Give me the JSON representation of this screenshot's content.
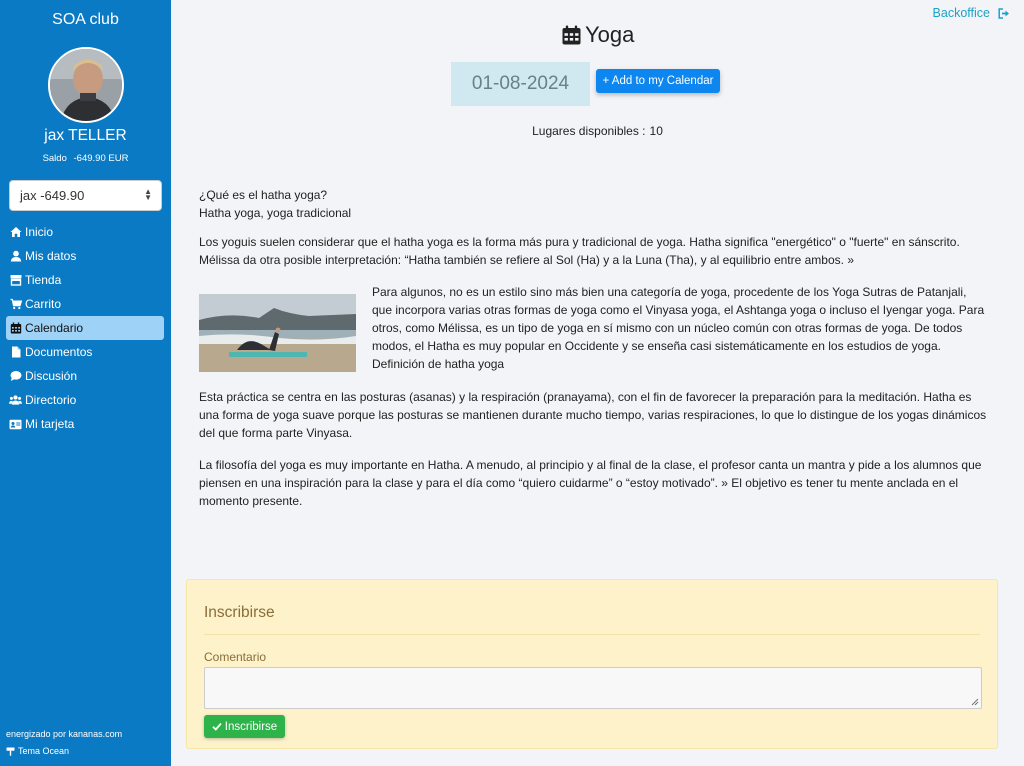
{
  "sidebar": {
    "club_title": "SOA club",
    "user_name": "jax TELLER",
    "saldo_label": "Saldo",
    "saldo_value": "-649.90 EUR",
    "account_select": "jax -649.90",
    "items": [
      {
        "label": "Inicio",
        "icon": "home-icon"
      },
      {
        "label": "Mis datos",
        "icon": "user-icon"
      },
      {
        "label": "Tienda",
        "icon": "store-icon"
      },
      {
        "label": "Carrito",
        "icon": "cart-icon"
      },
      {
        "label": "Calendario",
        "icon": "calendar-icon",
        "active": true
      },
      {
        "label": "Documentos",
        "icon": "document-icon"
      },
      {
        "label": "Discusión",
        "icon": "comment-icon"
      },
      {
        "label": "Directorio",
        "icon": "users-icon"
      },
      {
        "label": "Mi tarjeta",
        "icon": "id-card-icon"
      }
    ],
    "powered_by": "energizado por kananas.com",
    "theme": "Tema Ocean"
  },
  "header": {
    "backoffice": "Backoffice",
    "title": "Yoga",
    "date": "01-08-2024",
    "add_calendar": "+ Add to my Calendar",
    "places_label": "Lugares disponibles :",
    "places_value": "10"
  },
  "article": {
    "intro_q": "¿Qué es el hatha yoga?",
    "intro_sub": "Hatha yoga, yoga tradicional",
    "p1": "Los yoguis suelen considerar que el hatha yoga es la forma más pura y tradicional de yoga. Hatha significa \"energético\" o \"fuerte\" en sánscrito. Mélissa da otra posible interpretación: “Hatha también se refiere al Sol (Ha) y a la Luna (Tha), y al equilibrio entre ambos. »",
    "p2": "Para algunos, no es un estilo sino más bien una categoría de yoga, procedente de los Yoga Sutras de Patanjali, que incorpora varias otras formas de yoga como el Vinyasa yoga, el Ashtanga yoga o incluso el Iyengar yoga. Para otros, como Mélissa, es un tipo de yoga en sí mismo con un núcleo común con otras formas de yoga. De todos modos, el Hatha es muy popular en Occidente y se enseña casi sistemáticamente en los estudios de yoga.",
    "p2_sub": "Definición de hatha yoga",
    "p3": "Esta práctica se centra en las posturas (asanas) y la respiración (pranayama), con el fin de favorecer la preparación para la meditación. Hatha es una forma de yoga suave porque las posturas se mantienen durante mucho tiempo, varias respiraciones, lo que lo distingue de los yogas dinámicos del que forma parte Vinyasa.",
    "p4": "La filosofía del yoga es muy importante en Hatha. A menudo, al principio y al final de la clase, el profesor canta un mantra y pide a los alumnos que piensen en una inspiración para la clase y para el día como “quiero cuidarme” o “estoy motivado”. » El objetivo es tener tu mente anclada en el momento presente."
  },
  "form": {
    "title": "Inscribirse",
    "comment_label": "Comentario",
    "submit": "Inscribirse"
  },
  "colors": {
    "sidebar": "#0a7ac4",
    "active_item": "#9ed3f7",
    "primary_button": "#0d86f0",
    "success_button": "#2db34a",
    "form_panel": "#fdf2c9"
  }
}
